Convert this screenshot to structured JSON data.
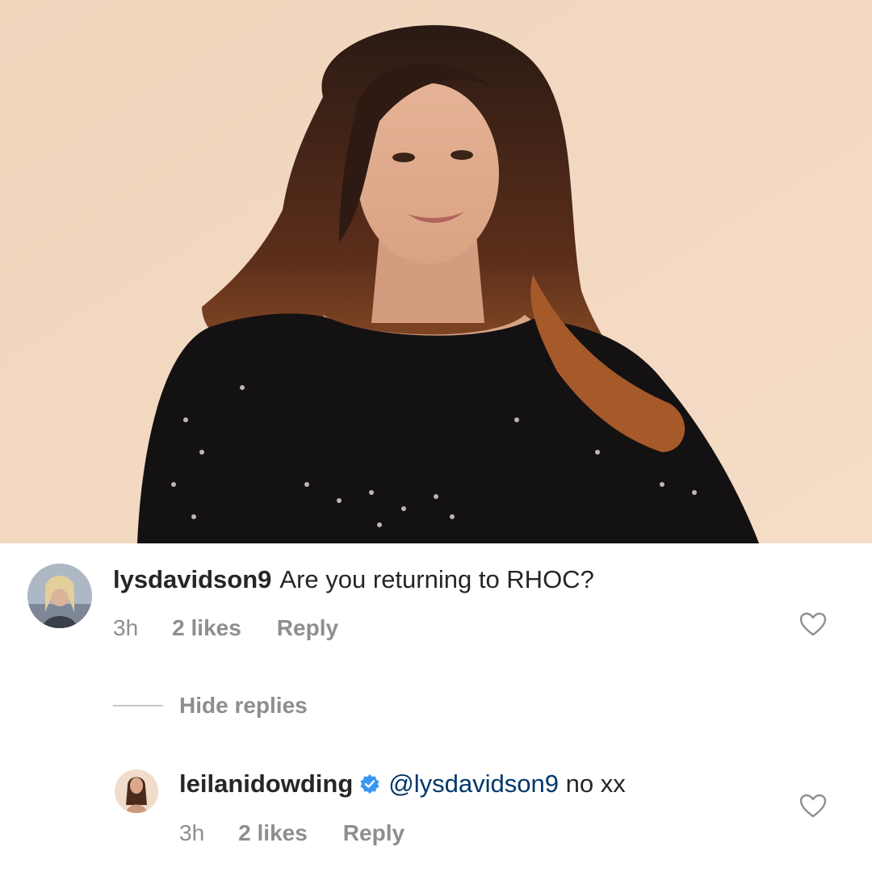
{
  "photo": {
    "description_icon": "photo",
    "background_color": "#f3d6bd"
  },
  "comments": [
    {
      "username": "lysdavidson9",
      "text": "Are you returning to RHOC?",
      "time": "3h",
      "likes": "2 likes",
      "reply_label": "Reply"
    }
  ],
  "hide_replies_label": "Hide replies",
  "replies": [
    {
      "username": "leilanidowding",
      "verified": true,
      "mention": "@lysdavidson9",
      "text": "no xx",
      "time": "3h",
      "likes": "2 likes",
      "reply_label": "Reply"
    }
  ],
  "colors": {
    "text": "#262626",
    "secondary": "#8e8e8e",
    "mention": "#00376b",
    "verified": "#3897f0"
  }
}
